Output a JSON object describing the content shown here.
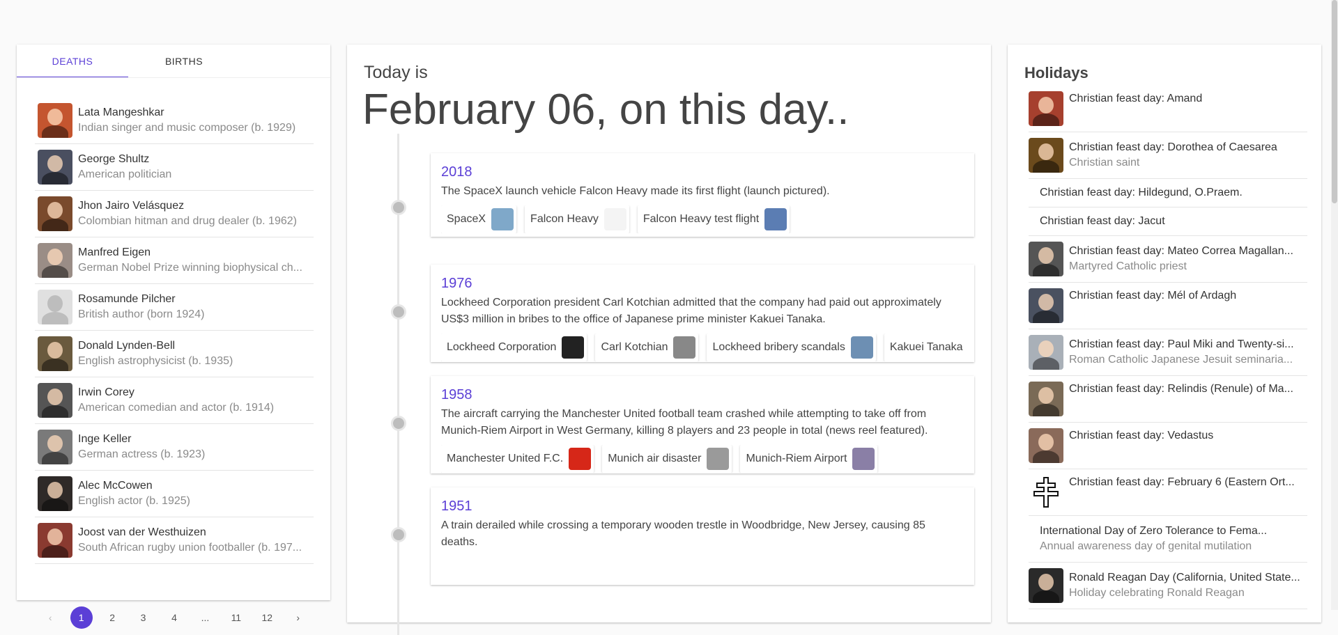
{
  "tabs": {
    "deaths": "DEATHS",
    "births": "BIRTHS"
  },
  "deaths": [
    {
      "name": "Lata Mangeshkar",
      "desc": "Indian singer and music composer (b. 1929)",
      "color": "#c4552f",
      "placeholder": false
    },
    {
      "name": "George Shultz",
      "desc": "American politician",
      "color": "#4a4f60",
      "placeholder": false
    },
    {
      "name": "Jhon Jairo Velásquez",
      "desc": "Colombian hitman and drug dealer (b. 1962)",
      "color": "#7a4a2c",
      "placeholder": false
    },
    {
      "name": "Manfred Eigen",
      "desc": "German Nobel Prize winning biophysical ch...",
      "color": "#9a8d86",
      "placeholder": false
    },
    {
      "name": "Rosamunde Pilcher",
      "desc": "British author (born 1924)",
      "color": "#e0e0e0",
      "placeholder": true
    },
    {
      "name": "Donald Lynden-Bell",
      "desc": "English astrophysicist (b. 1935)",
      "color": "#6a5a3e",
      "placeholder": false
    },
    {
      "name": "Irwin Corey",
      "desc": "American comedian and actor (b. 1914)",
      "color": "#555555",
      "placeholder": false
    },
    {
      "name": "Inge Keller",
      "desc": "German actress (b. 1923)",
      "color": "#7a7a7a",
      "placeholder": false
    },
    {
      "name": "Alec McCowen",
      "desc": "English actor (b. 1925)",
      "color": "#2f2a28",
      "placeholder": false
    },
    {
      "name": "Joost van der Westhuizen",
      "desc": "South African rugby union footballer (b. 197...",
      "color": "#8a3a30",
      "placeholder": false
    }
  ],
  "pagination": {
    "prev": "‹",
    "pages": [
      "1",
      "2",
      "3",
      "4",
      "...",
      "11",
      "12"
    ],
    "active": "1",
    "next": "›"
  },
  "header": {
    "today_label": "Today is",
    "title": "February 06, on this day.."
  },
  "events": [
    {
      "year": "2018",
      "text": "The SpaceX launch vehicle Falcon Heavy made its first flight (launch pictured).",
      "chips": [
        {
          "label": "SpaceX",
          "color": "#7fa8c9"
        },
        {
          "label": "Falcon Heavy",
          "color": "#f4f4f4"
        },
        {
          "label": "Falcon Heavy test flight",
          "color": "#5b7db3"
        }
      ]
    },
    {
      "year": "1976",
      "text": "Lockheed Corporation president Carl Kotchian admitted that the company had paid out approximately US$3 million in bribes to the office of Japanese prime minister Kakuei Tanaka.",
      "chips": [
        {
          "label": "Lockheed Corporation",
          "color": "#222222"
        },
        {
          "label": "Carl Kotchian",
          "color": "#888888"
        },
        {
          "label": "Lockheed bribery scandals",
          "color": "#6d8fb3"
        },
        {
          "label": "Kakuei Tanaka",
          "color": "#777777"
        }
      ]
    },
    {
      "year": "1958",
      "text": "The aircraft carrying the Manchester United football team crashed while attempting to take off from Munich-Riem Airport in West Germany, killing 8 players and 23 people in total (news reel featured).",
      "chips": [
        {
          "label": "Manchester United F.C.",
          "color": "#d62718"
        },
        {
          "label": "Munich air disaster",
          "color": "#9a9a9a"
        },
        {
          "label": "Munich-Riem Airport",
          "color": "#8a7fa6"
        }
      ]
    },
    {
      "year": "1951",
      "text": "A train derailed while crossing a temporary wooden trestle in Woodbridge, New Jersey, causing 85 deaths.",
      "chips": []
    }
  ],
  "holidays": {
    "title": "Holidays",
    "items": [
      {
        "name": "Christian feast day: Amand",
        "desc": "",
        "img": true,
        "color": "#a6402e"
      },
      {
        "name": "Christian feast day: Dorothea of Caesarea",
        "desc": "Christian saint",
        "img": true,
        "color": "#6b4a1c"
      },
      {
        "name": "Christian feast day: Hildegund, O.Praem.",
        "desc": "",
        "img": false
      },
      {
        "name": "Christian feast day: Jacut",
        "desc": "",
        "img": false
      },
      {
        "name": "Christian feast day: Mateo Correa Magallan...",
        "desc": "Martyred Catholic priest",
        "img": true,
        "color": "#555555"
      },
      {
        "name": "Christian feast day: Mél of Ardagh",
        "desc": "",
        "img": true,
        "color": "#4a5160"
      },
      {
        "name": "Christian feast day: Paul Miki and Twenty-si...",
        "desc": "Roman Catholic Japanese Jesuit seminaria...",
        "img": true,
        "color": "#a9b0b8"
      },
      {
        "name": "Christian feast day: Relindis (Renule) of Ma...",
        "desc": "",
        "img": true,
        "color": "#7a6a56"
      },
      {
        "name": "Christian feast day: Vedastus",
        "desc": "",
        "img": true,
        "color": "#8a6a5a"
      },
      {
        "name": "Christian feast day: February 6 (Eastern Ort...",
        "desc": "",
        "img": true,
        "color": "#ffffff",
        "cross": true
      },
      {
        "name": "International Day of Zero Tolerance to Fema...",
        "desc": "Annual awareness day of genital mutilation",
        "img": false
      },
      {
        "name": "Ronald Reagan Day (California, United State...",
        "desc": "Holiday celebrating Ronald Reagan",
        "img": true,
        "color": "#2a2a2a"
      }
    ]
  }
}
